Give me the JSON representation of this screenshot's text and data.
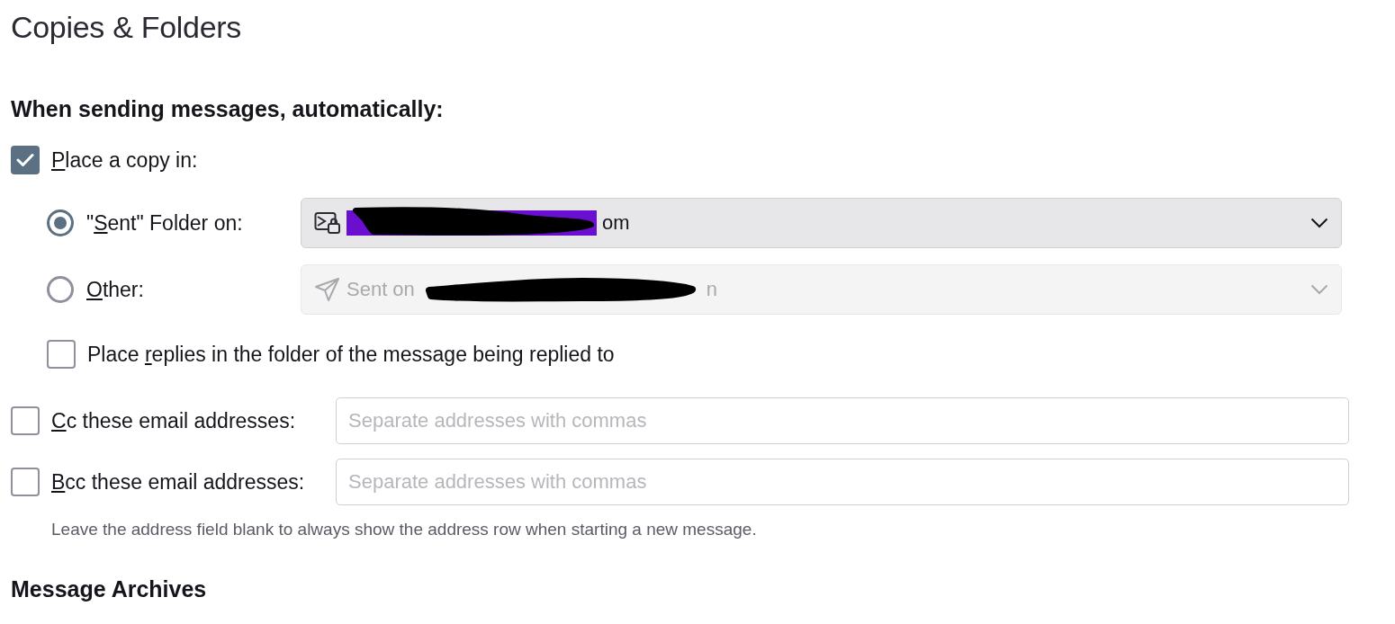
{
  "page_title": "Copies & Folders",
  "sending": {
    "heading": "When sending messages, automatically:",
    "place_copy": {
      "access_key": "P",
      "label_after": "lace a copy in:",
      "checked": true
    },
    "destinations": [
      {
        "label_before": "\"",
        "access_key": "S",
        "label_after": "ent\" Folder on:",
        "selected": true,
        "dropdown": {
          "text_end": "om",
          "disabled": false
        }
      },
      {
        "access_key": "O",
        "label_after": "ther:",
        "selected": false,
        "dropdown": {
          "text_start": "Sent on",
          "text_end": "n",
          "disabled": true
        }
      }
    ],
    "replies": {
      "label_before": "Place ",
      "access_key": "r",
      "label_after": "eplies in the folder of the message being replied to",
      "checked": false
    },
    "address_rows": [
      {
        "access_key": "C",
        "label_after": "c these email addresses:",
        "checked": false,
        "placeholder": "Separate addresses with commas"
      },
      {
        "access_key": "B",
        "label_after": "cc these email addresses:",
        "checked": false,
        "placeholder": "Separate addresses with commas"
      }
    ],
    "note": "Leave the address field blank to always show the address row when starting a new message."
  },
  "archives": {
    "heading": "Message Archives"
  }
}
